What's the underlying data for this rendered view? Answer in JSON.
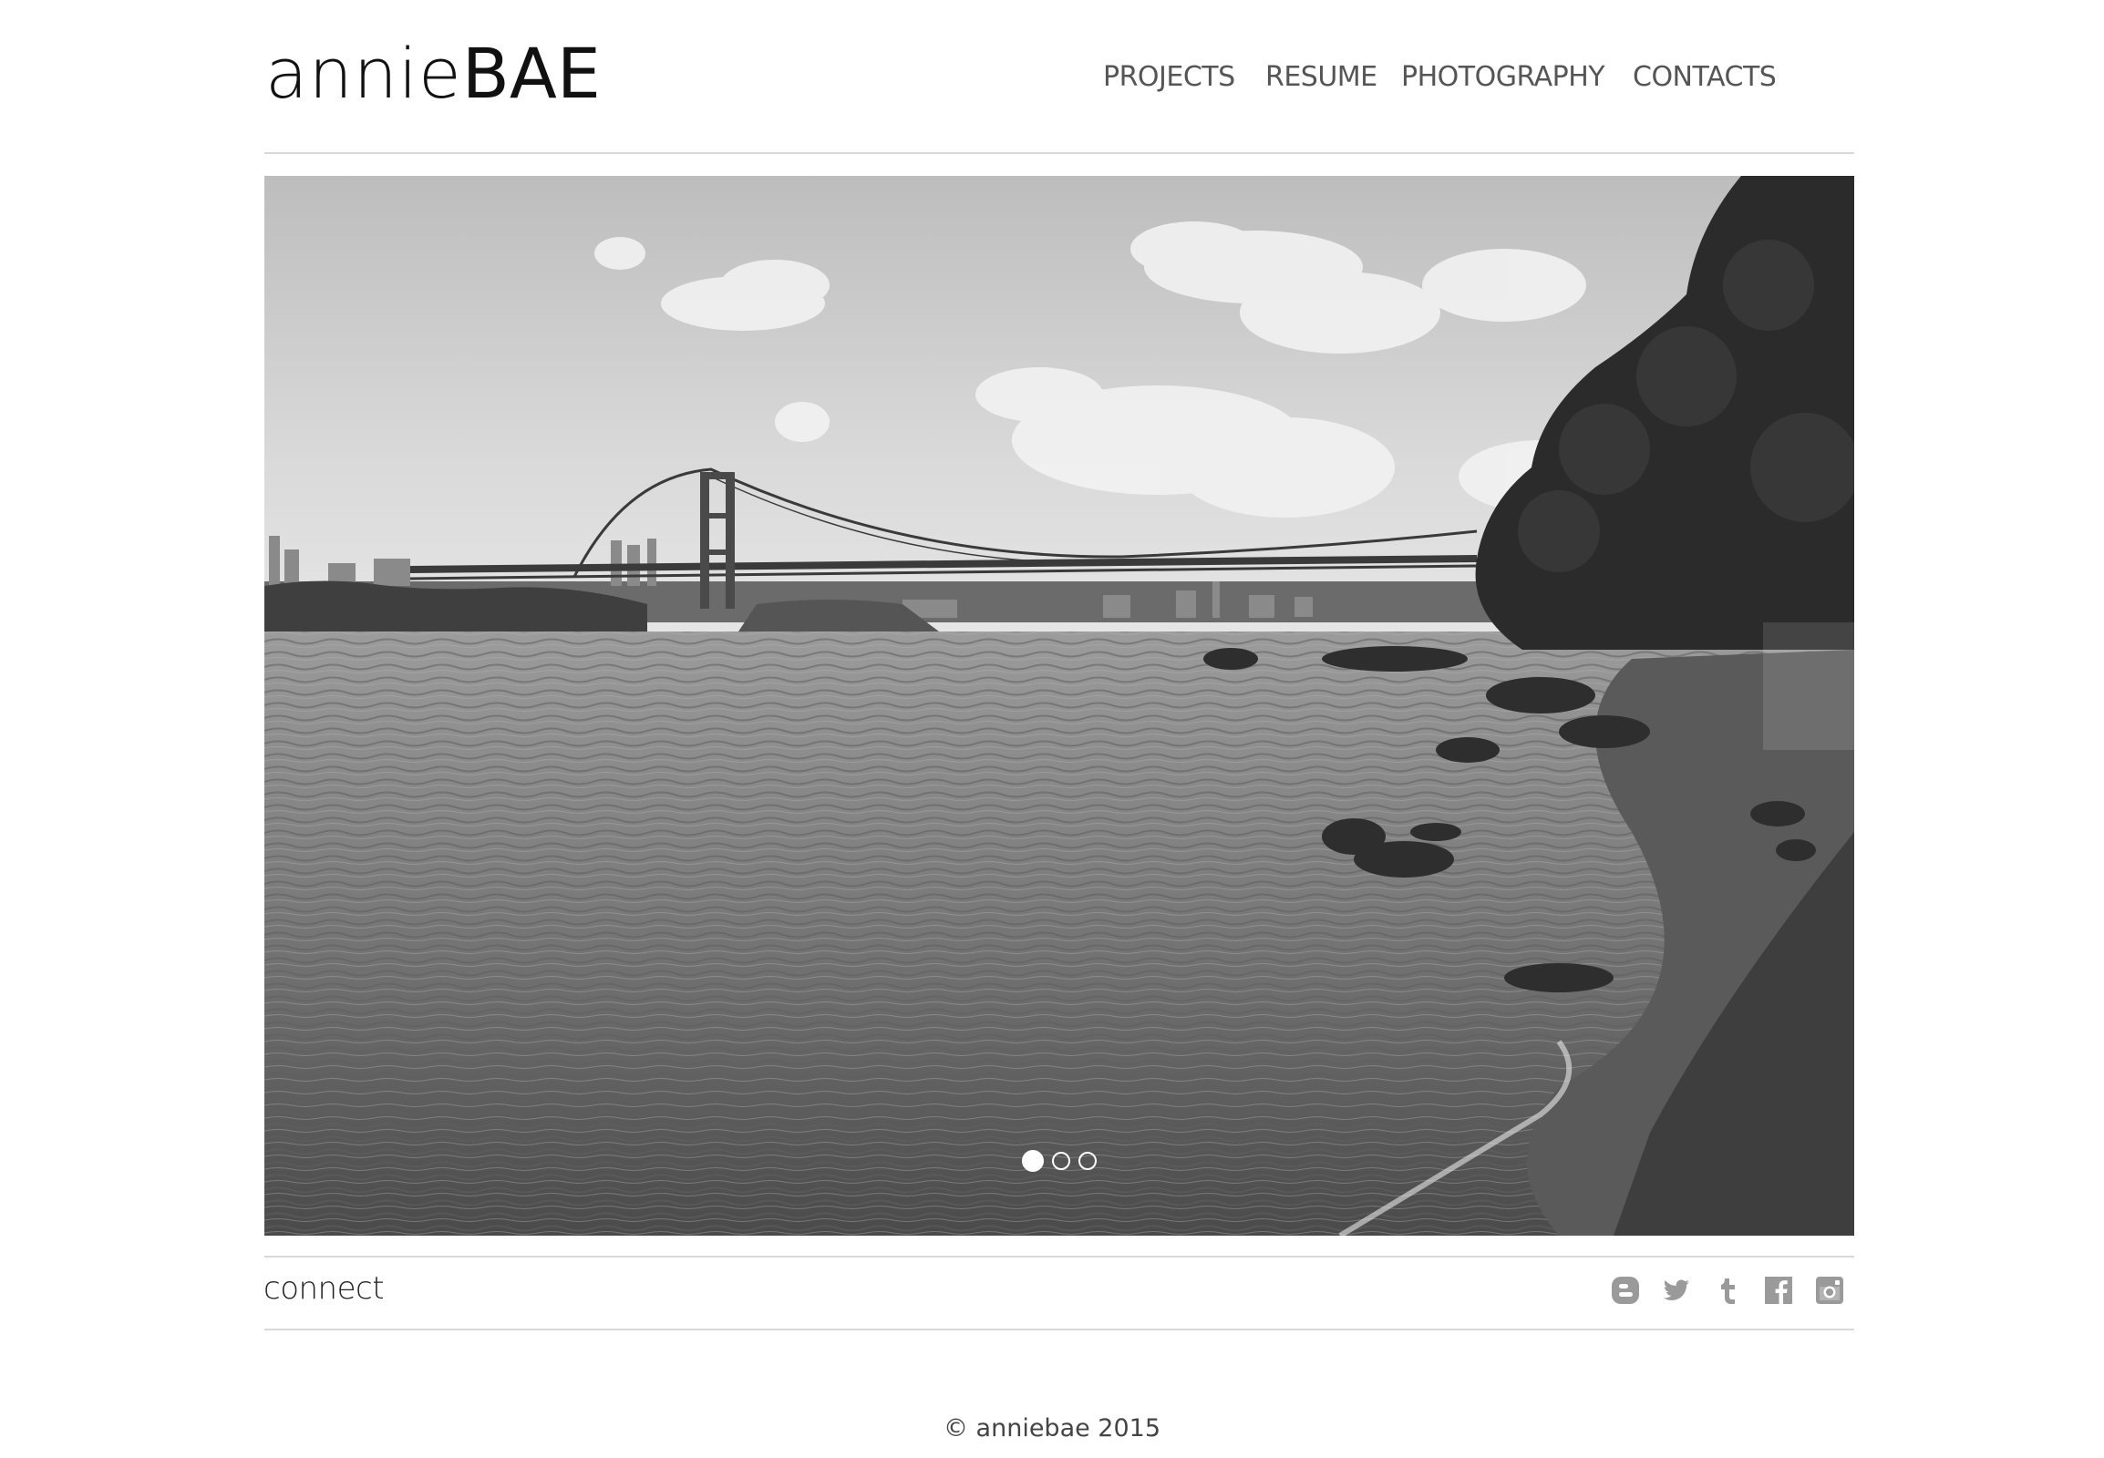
{
  "header": {
    "logo_light": "annie",
    "logo_bold": "BAE",
    "nav": [
      "PROJECTS",
      "RESUME",
      "PHOTOGRAPHY",
      "CONTACTS"
    ]
  },
  "slideshow": {
    "slide_count": 3,
    "active_index": 0,
    "image_subject": "black and white photo of a river with a suspension bridge and city skyline"
  },
  "connect": {
    "label": "connect",
    "social_icons": [
      "blogger-icon",
      "twitter-icon",
      "tumblr-icon",
      "facebook-icon",
      "instagram-icon"
    ]
  },
  "footer": {
    "copyright": "© anniebae 2015"
  },
  "colors": {
    "nav_text": "#555555",
    "rule": "#d8d8d8",
    "icon_gray": "#9a9a9a"
  }
}
